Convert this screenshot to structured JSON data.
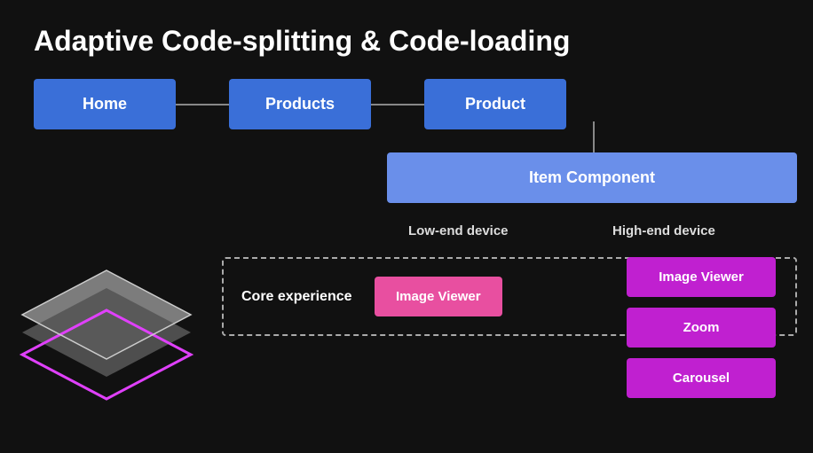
{
  "title": "Adaptive Code-splitting & Code-loading",
  "nav": {
    "home_label": "Home",
    "products_label": "Products",
    "product_label": "Product"
  },
  "item_component_label": "Item Component",
  "labels": {
    "lowend": "Low-end device",
    "highend": "High-end device",
    "core": "Core experience"
  },
  "components": {
    "image_viewer_label": "Image Viewer",
    "zoom_label": "Zoom",
    "carousel_label": "Carousel"
  }
}
